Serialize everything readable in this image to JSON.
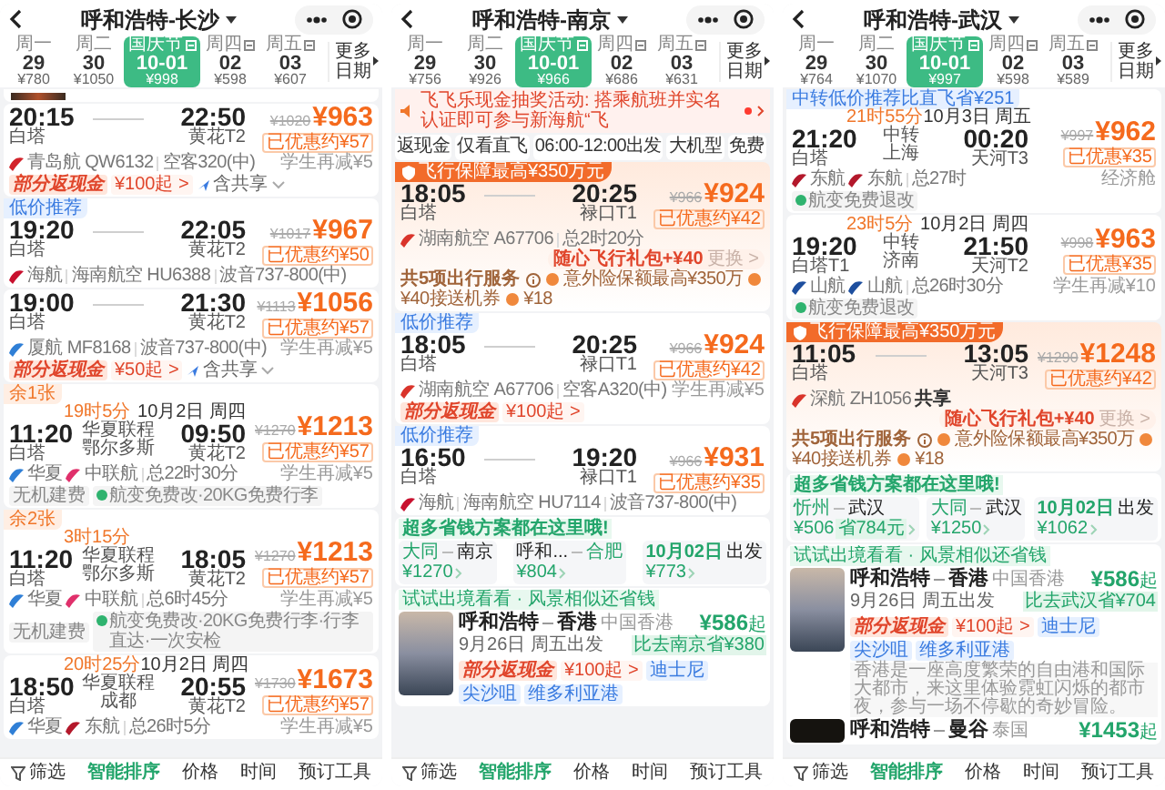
{
  "panels": [
    {
      "title": "呼和浩特-长沙",
      "partial_banner": true,
      "dates": [
        {
          "weekday": "周一",
          "day": "29",
          "price": "¥780",
          "selected": false,
          "holiday": false
        },
        {
          "weekday": "周二",
          "day": "30",
          "price": "¥1050",
          "selected": false,
          "holiday": false
        },
        {
          "weekday": "国庆节",
          "day": "10-01",
          "price": "¥998",
          "selected": true,
          "holiday": true
        },
        {
          "weekday": "周四",
          "day": "02",
          "price": "¥598",
          "selected": false,
          "holiday": true
        },
        {
          "weekday": "周五",
          "day": "03",
          "price": "¥607",
          "selected": false,
          "holiday": true
        }
      ],
      "more_dates": "更多日期",
      "flights": [
        {
          "dep_time": "20:15",
          "dep_airport": "白塔",
          "arr_time": "22:50",
          "arr_airport": "黄花T2",
          "old_price": "¥1020",
          "price": "¥963",
          "discount": "已优惠约¥57",
          "extra": "学生再减¥5",
          "segments": [
            {
              "kind": "airline",
              "text": "青岛航 QW6132",
              "color": "#d2232a"
            },
            {
              "kind": "text",
              "text": "空客320(中)"
            }
          ],
          "tags": [
            {
              "kind": "promo",
              "text": "部分返现金"
            },
            {
              "kind": "plain",
              "text": "¥100起 >"
            },
            {
              "kind": "share",
              "text": "含共享"
            }
          ],
          "expandable": true
        },
        {
          "badge": {
            "kind": "blue",
            "text": "低价推荐"
          },
          "dep_time": "19:20",
          "dep_airport": "白塔",
          "arr_time": "22:05",
          "arr_airport": "黄花T2",
          "old_price": "¥1017",
          "price": "¥967",
          "discount": "已优惠约¥50",
          "segments": [
            {
              "kind": "airline",
              "text": "海航",
              "color": "#c8102e"
            },
            {
              "kind": "text",
              "text": "海南航空 HU6388"
            },
            {
              "kind": "text",
              "text": "波音737-800(中)"
            }
          ]
        },
        {
          "dep_time": "19:00",
          "dep_airport": "白塔",
          "arr_time": "21:30",
          "arr_airport": "黄花T2",
          "old_price": "¥1113",
          "price": "¥1056",
          "discount": "已优惠约¥57",
          "extra": "学生再减¥5",
          "segments": [
            {
              "kind": "airline",
              "text": "厦航 MF8168",
              "color": "#2f7fd6"
            },
            {
              "kind": "text",
              "text": "波音737-800(中)"
            }
          ],
          "tags": [
            {
              "kind": "promo",
              "text": "部分返现金"
            },
            {
              "kind": "plain",
              "text": "¥50起 >"
            },
            {
              "kind": "share",
              "text": "含共享"
            }
          ],
          "expandable": true
        },
        {
          "badge": {
            "kind": "orange",
            "text": "余1张"
          },
          "dep_time": "11:20",
          "dep_airport": "白塔",
          "transfer": {
            "duration": "19时5分",
            "via": [
              "华夏联程",
              "鄂尔多斯"
            ]
          },
          "arr_date": "10月2日 周四",
          "arr_time": "09:50",
          "arr_airport": "黄花T2",
          "old_price": "¥1270",
          "price": "¥1213",
          "discount": "已优惠约¥57",
          "extra": "学生再减¥5",
          "segments": [
            {
              "kind": "airline",
              "text": "华夏",
              "color": "#2f7fd6"
            },
            {
              "kind": "airline",
              "text": "中联航",
              "color": "#e0306b"
            },
            {
              "kind": "text",
              "text": "总22时30分"
            }
          ],
          "tags": [
            {
              "kind": "box",
              "text": "无机建费"
            },
            {
              "kind": "ok",
              "text": "航变免费改·20KG免费行李"
            }
          ]
        },
        {
          "badge": {
            "kind": "orange",
            "text": "余2张"
          },
          "dep_time": "11:20",
          "dep_airport": "白塔",
          "transfer": {
            "duration": "3时15分",
            "via": [
              "华夏联程",
              "鄂尔多斯"
            ]
          },
          "arr_time": "18:05",
          "arr_airport": "黄花T2",
          "old_price": "¥1270",
          "price": "¥1213",
          "discount": "已优惠约¥57",
          "extra": "学生再减¥5",
          "segments": [
            {
              "kind": "airline",
              "text": "华夏",
              "color": "#2f7fd6"
            },
            {
              "kind": "airline",
              "text": "中联航",
              "color": "#e0306b"
            },
            {
              "kind": "text",
              "text": "总6时45分"
            }
          ],
          "tags": [
            {
              "kind": "box",
              "text": "无机建费"
            },
            {
              "kind": "ok",
              "text": "航变免费改·20KG免费行李·行李直达·一次安检"
            }
          ]
        },
        {
          "dep_time": "18:50",
          "dep_airport": "白塔",
          "transfer": {
            "duration": "20时25分",
            "via": [
              "华夏联程",
              "成都"
            ]
          },
          "arr_date": "10月2日 周四",
          "arr_time": "20:55",
          "arr_airport": "黄花T2",
          "old_price": "¥1730",
          "price": "¥1673",
          "discount": "已优惠约¥57",
          "extra": "学生再减¥5",
          "segments": [
            {
              "kind": "airline",
              "text": "华夏",
              "color": "#2f7fd6"
            },
            {
              "kind": "airline",
              "text": "东航",
              "color": "#b3182b"
            },
            {
              "kind": "text",
              "text": "总26时5分"
            }
          ]
        }
      ],
      "tabs": [
        {
          "label": "筛选",
          "kind": "filter",
          "selected": false
        },
        {
          "label": "智能排序",
          "selected": true
        },
        {
          "label": "价格",
          "selected": false
        },
        {
          "label": "时间",
          "selected": false
        },
        {
          "label": "预订工具",
          "selected": false
        }
      ]
    },
    {
      "title": "呼和浩特-南京",
      "dates": [
        {
          "weekday": "周一",
          "day": "29",
          "price": "¥756",
          "selected": false,
          "holiday": false
        },
        {
          "weekday": "周二",
          "day": "30",
          "price": "¥926",
          "selected": false,
          "holiday": false
        },
        {
          "weekday": "国庆节",
          "day": "10-01",
          "price": "¥966",
          "selected": true,
          "holiday": true
        },
        {
          "weekday": "周四",
          "day": "02",
          "price": "¥686",
          "selected": false,
          "holiday": true
        },
        {
          "weekday": "周五",
          "day": "03",
          "price": "¥631",
          "selected": false,
          "holiday": true
        }
      ],
      "more_dates": "更多日期",
      "notice": "飞飞乐现金抽奖活动: 搭乘航班并实名认证即可参与新海航“飞",
      "filters": [
        "返现金",
        "仅看直飞",
        "06:00-12:00出发",
        "大机型",
        "免费"
      ],
      "flights": [
        {
          "badge": {
            "kind": "insurance",
            "text": "飞行保障最高¥350万元"
          },
          "dep_time": "18:05",
          "dep_airport": "白塔",
          "arr_time": "20:25",
          "arr_airport": "禄口T1",
          "old_price": "¥966",
          "price": "¥924",
          "discount": "已优惠约¥42",
          "segments": [
            {
              "kind": "airline",
              "text": "湖南航空 A67706",
              "color": "#d9342b"
            },
            {
              "kind": "text",
              "text": "总2时20分"
            }
          ],
          "gift": {
            "text": "随心飞行礼包+¥40",
            "action": "更换 >"
          },
          "services": {
            "label": "共5项出行服务",
            "items": [
              "意外险保额最高¥350万",
              "¥40接送机券",
              "¥18"
            ]
          }
        },
        {
          "badge": {
            "kind": "blue",
            "text": "低价推荐"
          },
          "dep_time": "18:05",
          "dep_airport": "白塔",
          "arr_time": "20:25",
          "arr_airport": "禄口T1",
          "old_price": "¥966",
          "price": "¥924",
          "discount": "已优惠约¥42",
          "extra": "学生再减¥5",
          "segments": [
            {
              "kind": "airline",
              "text": "湖南航空 A67706",
              "color": "#d9342b"
            },
            {
              "kind": "text",
              "text": "空客A320(中)"
            }
          ],
          "tags": [
            {
              "kind": "promo",
              "text": "部分返现金"
            },
            {
              "kind": "plain",
              "text": "¥100起 >"
            }
          ]
        },
        {
          "badge": {
            "kind": "blue",
            "text": "低价推荐"
          },
          "dep_time": "16:50",
          "dep_airport": "白塔",
          "arr_time": "19:20",
          "arr_airport": "禄口T1",
          "old_price": "¥966",
          "price": "¥931",
          "discount": "已优惠约¥35",
          "segments": [
            {
              "kind": "airline",
              "text": "海航",
              "color": "#c8102e"
            },
            {
              "kind": "text",
              "text": "海南航空 HU7114"
            },
            {
              "kind": "text",
              "text": "波音737-800(中)"
            }
          ]
        }
      ],
      "savings": {
        "title": "超多省钱方案都在这里哦!",
        "options": [
          {
            "kind": "route",
            "from": "大同",
            "to": "南京",
            "from_highlight": true,
            "to_highlight": false,
            "price": "¥1270"
          },
          {
            "kind": "route",
            "from": "呼和...",
            "to": "合肥",
            "from_highlight": false,
            "to_highlight": true,
            "price": "¥804"
          },
          {
            "kind": "date",
            "date": "10月02日",
            "suffix": "出发",
            "price": "¥773"
          }
        ]
      },
      "destinations": {
        "title": "试试出境看看 · 风景相似还省钱",
        "items": [
          {
            "from": "呼和浩特",
            "to": "香港",
            "region": "中国香港",
            "date": "9月26日 周五出发",
            "price": "¥586",
            "price_suffix": "起",
            "compare": "比去南京省¥380",
            "photo": {
              "kind": "dusk"
            },
            "tags": [
              {
                "kind": "promo",
                "text": "部分返现金"
              },
              {
                "kind": "plain",
                "text": "¥100起 >"
              },
              {
                "kind": "spot",
                "text": "迪士尼"
              },
              {
                "kind": "spot",
                "text": "尖沙咀"
              },
              {
                "kind": "spot",
                "text": "维多利亚港"
              }
            ]
          }
        ]
      },
      "tabs": [
        {
          "label": "筛选",
          "kind": "filter",
          "selected": false
        },
        {
          "label": "智能排序",
          "selected": true
        },
        {
          "label": "价格",
          "selected": false
        },
        {
          "label": "时间",
          "selected": false
        },
        {
          "label": "预订工具",
          "selected": false
        }
      ]
    },
    {
      "title": "呼和浩特-武汉",
      "dates": [
        {
          "weekday": "周一",
          "day": "29",
          "price": "¥764",
          "selected": false,
          "holiday": false
        },
        {
          "weekday": "周二",
          "day": "30",
          "price": "¥1070",
          "selected": false,
          "holiday": false
        },
        {
          "weekday": "国庆节",
          "day": "10-01",
          "price": "¥997",
          "selected": true,
          "holiday": true
        },
        {
          "weekday": "周四",
          "day": "02",
          "price": "¥598",
          "selected": false,
          "holiday": true
        },
        {
          "weekday": "周五",
          "day": "03",
          "price": "¥589",
          "selected": false,
          "holiday": true
        }
      ],
      "more_dates": "更多日期",
      "flights": [
        {
          "badge": {
            "kind": "blue",
            "text": "中转低价推荐比直飞省¥251"
          },
          "dep_time": "21:20",
          "dep_airport": "白塔",
          "transfer": {
            "duration": "21时55分",
            "via": [
              "中转",
              "上海"
            ]
          },
          "arr_date": "10月3日 周五",
          "arr_time": "00:20",
          "arr_airport": "天河T3",
          "old_price": "¥997",
          "price": "¥962",
          "discount": "已优惠¥35",
          "extra": "经济舱",
          "segments": [
            {
              "kind": "airline",
              "text": "东航",
              "color": "#b3182b"
            },
            {
              "kind": "airline",
              "text": "东航",
              "color": "#b3182b"
            },
            {
              "kind": "text",
              "text": "总27时"
            }
          ],
          "tags": [
            {
              "kind": "ok",
              "text": "航变免费退改"
            }
          ]
        },
        {
          "dep_time": "19:20",
          "dep_airport": "白塔T1",
          "transfer": {
            "duration": "23时5分",
            "via": [
              "中转",
              "济南"
            ]
          },
          "arr_date": "10月2日 周四",
          "arr_time": "21:50",
          "arr_airport": "天河T2",
          "old_price": "¥998",
          "price": "¥963",
          "discount": "已优惠¥35",
          "extra": "学生再减¥10",
          "segments": [
            {
              "kind": "airline",
              "text": "山航",
              "color": "#1d4e9e"
            },
            {
              "kind": "airline",
              "text": "山航",
              "color": "#1d4e9e"
            },
            {
              "kind": "text",
              "text": "总26时30分"
            }
          ],
          "tags": [
            {
              "kind": "ok",
              "text": "航变免费退改"
            }
          ]
        },
        {
          "badge": {
            "kind": "insurance",
            "text": "飞行保障最高¥350万元"
          },
          "dep_time": "11:05",
          "dep_airport": "白塔",
          "arr_time": "13:05",
          "arr_airport": "天河T3",
          "old_price": "¥1290",
          "price": "¥1248",
          "discount": "已优惠约¥42",
          "segments": [
            {
              "kind": "airline",
              "text": "深航 ZH1056",
              "color": "#d9342b"
            },
            {
              "kind": "strong",
              "text": "共享"
            }
          ],
          "gift": {
            "text": "随心飞行礼包+¥40",
            "action": "更换 >"
          },
          "services": {
            "label": "共5项出行服务",
            "items": [
              "意外险保额最高¥350万",
              "¥40接送机券",
              "¥18"
            ]
          }
        }
      ],
      "savings": {
        "title": "超多省钱方案都在这里哦!",
        "options": [
          {
            "kind": "route",
            "from": "忻州",
            "to": "武汉",
            "from_highlight": true,
            "to_highlight": false,
            "price": "¥506",
            "save": "省784元"
          },
          {
            "kind": "route",
            "from": "大同",
            "to": "武汉",
            "from_highlight": true,
            "to_highlight": false,
            "price": "¥1250"
          },
          {
            "kind": "date",
            "date": "10月02日",
            "suffix": "出发",
            "price": "¥1062"
          }
        ]
      },
      "destinations": {
        "title": "试试出境看看 · 风景相似还省钱",
        "items": [
          {
            "from": "呼和浩特",
            "to": "香港",
            "region": "中国香港",
            "date": "9月26日 周五出发",
            "price": "¥586",
            "price_suffix": "起",
            "compare": "比去武汉省¥704",
            "photo": {
              "kind": "dusk"
            },
            "tags": [
              {
                "kind": "promo",
                "text": "部分返现金"
              },
              {
                "kind": "plain",
                "text": "¥100起 >"
              },
              {
                "kind": "spot",
                "text": "迪士尼"
              },
              {
                "kind": "spot",
                "text": "尖沙咀"
              },
              {
                "kind": "spot",
                "text": "维多利亚港"
              }
            ],
            "desc": "香港是一座高度繁荣的自由港和国际大都市，来这里体验霓虹闪烁的都市夜，参与一场不停歇的奇妙冒险。"
          },
          {
            "from": "呼和浩特",
            "to": "曼谷",
            "region": "泰国",
            "price": "¥1453",
            "price_suffix": "起",
            "photo": {
              "kind": "night"
            }
          }
        ]
      },
      "tabs": [
        {
          "label": "筛选",
          "kind": "filter",
          "selected": false
        },
        {
          "label": "智能排序",
          "selected": true
        },
        {
          "label": "价格",
          "selected": false
        },
        {
          "label": "时间",
          "selected": false
        },
        {
          "label": "预订工具",
          "selected": false
        }
      ]
    }
  ]
}
